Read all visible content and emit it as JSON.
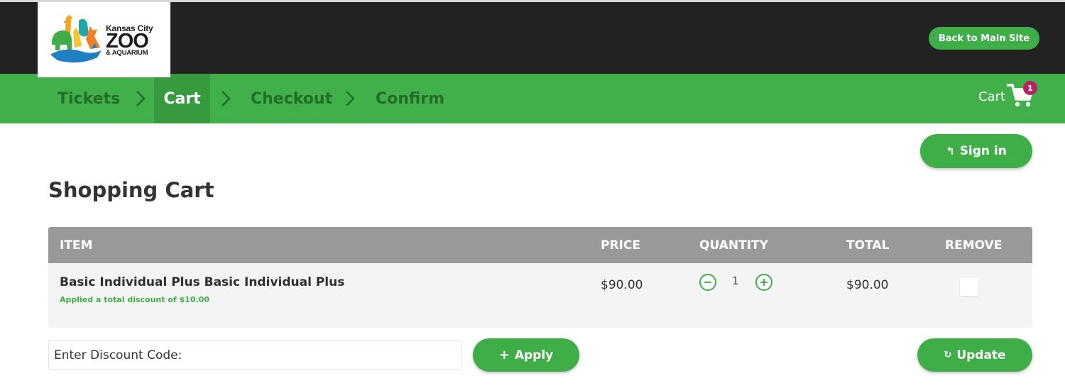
{
  "header": {
    "logo": {
      "line1": "Kansas City",
      "line2": "ZOO",
      "line3": "& AQUARIUM"
    },
    "back_button": "Back to Main Site"
  },
  "steps": [
    {
      "label": "Tickets",
      "active": false
    },
    {
      "label": "Cart",
      "active": true
    },
    {
      "label": "Checkout",
      "active": false
    },
    {
      "label": "Confirm",
      "active": false
    }
  ],
  "cart": {
    "label": "Cart",
    "count": "1",
    "icon": "shopping-cart-icon"
  },
  "signin": {
    "label": "Sign in",
    "icon": "reply-arrow-icon"
  },
  "page_title": "Shopping Cart",
  "table": {
    "headers": {
      "item": "ITEM",
      "price": "PRICE",
      "quantity": "QUANTITY",
      "total": "TOTAL",
      "remove": "REMOVE"
    },
    "rows": [
      {
        "name": "Basic Individual Plus Basic Individual Plus",
        "discount_note": "Applied a total discount of $10.00",
        "price": "$90.00",
        "quantity": "1",
        "total": "$90.00",
        "remove_checked": false
      }
    ]
  },
  "discount": {
    "placeholder": "Enter Discount Code:",
    "value": ""
  },
  "apply_button": {
    "label": "Apply",
    "icon": "+"
  },
  "update_button": {
    "label": "Update",
    "icon": "refresh-icon"
  },
  "colors": {
    "brand_green": "#41b04a",
    "button_green": "#3fae49",
    "dark_header": "#222222",
    "table_header": "#999999",
    "badge": "#b5245f"
  }
}
